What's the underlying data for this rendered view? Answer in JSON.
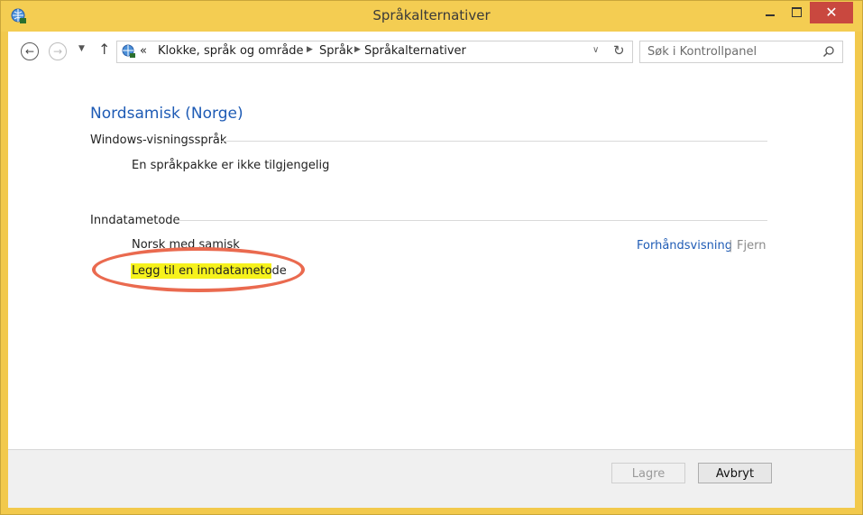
{
  "window": {
    "title": "Språkalternativer",
    "close_glyph": "✕"
  },
  "nav": {
    "back_glyph": "←",
    "forward_glyph": "→",
    "dropdown_glyph": "▼",
    "up_glyph": "↑"
  },
  "address": {
    "overflow": "«",
    "crumbs": [
      "Klokke, språk og område",
      "Språk",
      "Språkalternativer"
    ],
    "separator_glyph": "▶",
    "dropdown_glyph": "∨",
    "refresh_glyph": "↻"
  },
  "search": {
    "placeholder": "Søk i Kontrollpanel"
  },
  "content": {
    "language_heading": "Nordsamisk (Norge)",
    "display_section": {
      "label": "Windows-visningsspråk",
      "status": "En språkpakke er ikke tilgjengelig"
    },
    "input_section": {
      "label": "Inndatametode",
      "method_name": "Norsk med samisk",
      "preview_link": "Forhåndsvisning",
      "separator": "|",
      "remove_link": "Fjern",
      "add_link": "Legg til en inndatametode"
    }
  },
  "footer": {
    "save_label": "Lagre",
    "cancel_label": "Avbryt"
  },
  "colors": {
    "titlebar": "#f4cd52",
    "link": "#1e5bb5",
    "highlight": "#f6f21c",
    "annotation_ellipse": "#ea6a4f",
    "close_button": "#c9483f"
  }
}
